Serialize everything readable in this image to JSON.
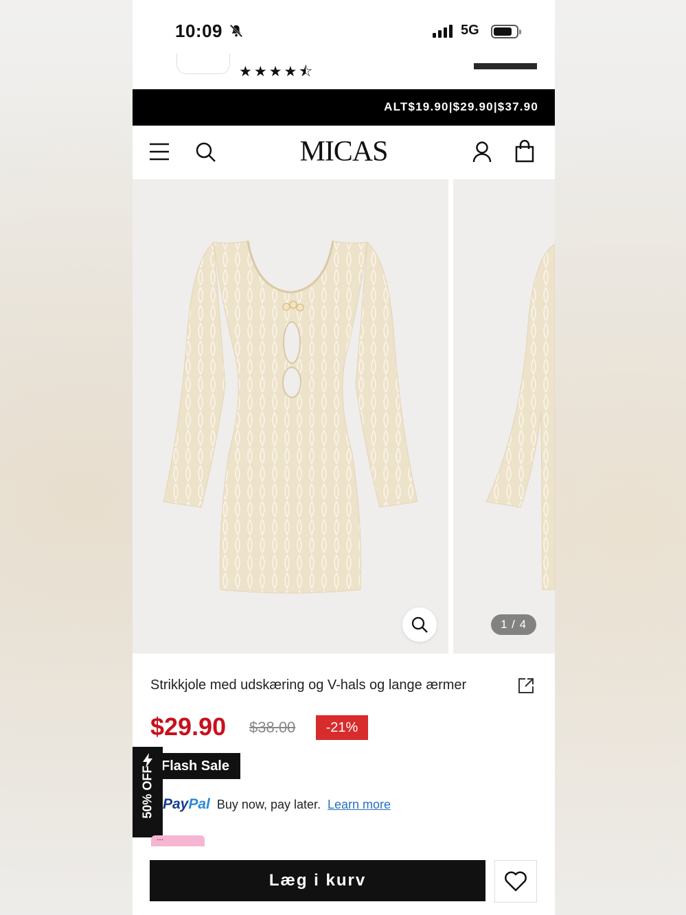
{
  "status_bar": {
    "time": "10:09",
    "network": "5G",
    "bell_icon": "bell-slash-icon"
  },
  "review": {
    "rating": 4.5,
    "max_rating": 5,
    "stars": "★★★★⯪"
  },
  "promo": {
    "text": "ALT$19.90|$29.90|$37.90"
  },
  "nav": {
    "brand": "MICAS",
    "icons": [
      "menu-icon",
      "search-icon",
      "account-icon",
      "bag-icon"
    ]
  },
  "gallery": {
    "counter": "1 / 4",
    "current": 1,
    "total": 4
  },
  "product": {
    "title": "Strikkjole med udskæring og V-hals og lange ærmer",
    "price": "$29.90",
    "old_price": "$38.00",
    "discount": "-21%",
    "flash_label": "Flash Sale",
    "ribbon_label": "50% OFF"
  },
  "payment": {
    "paypal_logo_a": "Pay",
    "paypal_logo_b": "Pal",
    "text": "Buy now, pay later.",
    "link": "Learn more"
  },
  "actions": {
    "add_to_cart": "Læg i kurv"
  },
  "colors": {
    "price_red": "#c8101e",
    "discount_red": "#d82b2b",
    "black": "#111111",
    "paypal_blue": "#1a3b8e"
  }
}
